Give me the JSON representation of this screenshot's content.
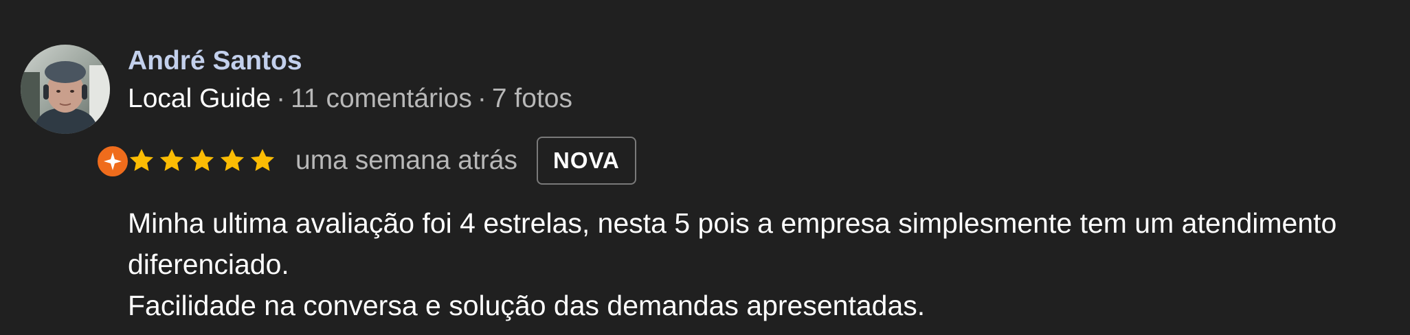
{
  "review": {
    "author": {
      "name": "André Santos",
      "avatar_icon": "user-photo",
      "badge_icon": "local-guide-star-icon",
      "badge_color": "#ef6c1c",
      "name_color": "#c3d0ec"
    },
    "meta": {
      "guide_label": "Local Guide",
      "separator": "·",
      "reviews_count": "11 comentários",
      "photos_count": "7 fotos"
    },
    "rating": {
      "stars": 5,
      "max_stars": 5,
      "star_color": "#fbbc04",
      "time_ago": "uma semana atrás",
      "new_label": "NOVA"
    },
    "text": {
      "line1": "Minha ultima avaliação foi 4 estrelas, nesta 5 pois a empresa simplesmente tem um atendimento diferenciado.",
      "line2": "Facilidade na conversa e solução das demandas apresentadas."
    }
  }
}
